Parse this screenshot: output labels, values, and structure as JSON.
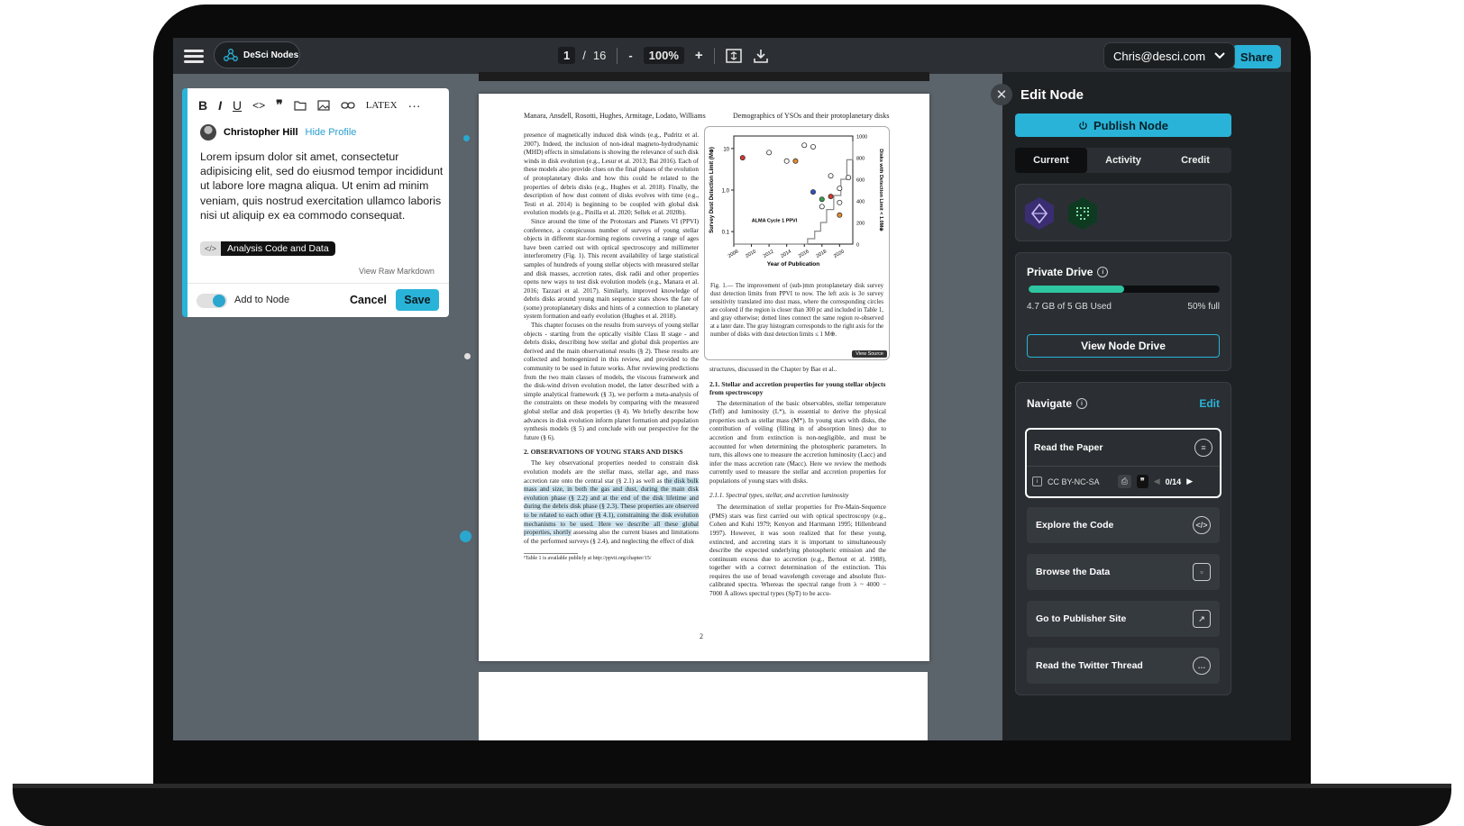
{
  "brand": {
    "name": "DeSci Nodes"
  },
  "toolbar": {
    "page_current": "1",
    "page_separator": "/",
    "page_total": "16",
    "zoom_out": "-",
    "zoom": "100%",
    "zoom_in": "+",
    "share_label": "Share",
    "user_email": "Chris@desci.com"
  },
  "editor": {
    "tools": [
      "B",
      "I",
      "U",
      "<>",
      "❞",
      "LATEX",
      "···"
    ],
    "author_name": "Christopher Hill",
    "hide_profile": "Hide Profile",
    "text": "Lorem ipsum dolor sit amet, consectetur adipisicing elit, sed do eiusmod tempor incididunt ut labore    lore magna aliqua. Ut enim ad minim veniam, quis nostrud exercitation ullamco laboris nisi ut aliquip ex ea commodo consequat.",
    "chip_icon": "</>",
    "chip_label": "Analysis Code and Data",
    "view_raw": "View Raw Markdown",
    "add_to_node": "Add to Node",
    "cancel": "Cancel",
    "save": "Save"
  },
  "pdf": {
    "running_head_left": "Manara, Ansdell, Rosotti, Hughes, Armitage, Lodato, Williams",
    "running_head_right": "Demographics of YSOs and their protoplanetary disks",
    "left_col_1": "presence of magnetically induced disk winds (e.g., Pudritz et al. 2007). Indeed, the inclusion of non-ideal magneto-hydrodynamic (MHD) effects in simulations is showing the relevance of such disk winds in disk evolution (e.g., Lesur et al. 2013; Bai 2016). Each of these models also provide clues on the final phases of the evolution of protoplanetary disks and how this could be related to the properties of debris disks (e.g., Hughes et al. 2018). Finally, the description of how dust content of disks evolves with time (e.g., Testi et al. 2014) is beginning to be coupled with global disk evolution models (e.g., Pinilla et al. 2020; Sellek et al. 2020b).",
    "left_col_2": "Since around the time of the Protostars and Planets VI (PPVI) conference, a conspicuous number of surveys of young stellar objects in different star-forming regions covering a range of ages have been carried out with optical spectroscopy and millimeter interferometry (Fig. 1). This recent availability of large statistical samples of hundreds of young stellar objects with measured stellar and disk masses, accretion rates, disk radii and other properties opens new ways to test disk evolution models (e.g., Manara et al. 2016; Tazzari et al. 2017). Similarly, improved knowledge of debris disks around young main sequence stars shows the fate of (some) protoplanetary disks and hints of a connection to planetary system formation and early evolution (Hughes et al. 2018).",
    "left_col_3": "This chapter focuses on the results from surveys of young stellar objects - starting from the optically visible Class II stage - and debris disks, describing how stellar and global disk properties are derived and the main observational results (§ 2). These results are collected and homogenized in this review, and provided to the community to be used in future works. After reviewing predictions from the two main classes of models, the viscous framework and the disk-wind driven evolution model, the latter described with a simple analytical framework (§ 3), we perform a meta-analysis of the constraints on these models by comparing with the measured global stellar and disk properties (§ 4). We briefly describe how advances in disk evolution inform planet formation and population synthesis models (§ 5) and conclude with our perspective for the future (§ 6).",
    "heading_2": "2.   OBSERVATIONS OF YOUNG STARS AND DISKS",
    "left_col_4a": "The key observational properties needed to constrain disk evolution models are the stellar mass, stellar age, and mass accretion rate onto the central star (§ 2.1) as well as",
    "left_col_4_highlight": "the disk bulk mass and size, in both the gas and dust, during the main disk evolution phase (§ 2.2) and at the end of the disk lifetime and during the debris disk phase (§ 2.3). These properties are observed to be related to each other (§ 4.1), constraining the disk evolution mechanisms to be used. Here we describe all these global properties, shortly",
    "left_col_4b": "assessing also the current biases and limitations of the performed surveys (§ 2.4), and neglecting the effect of disk",
    "footnote": "¹Table 1 is available publicly at http://ppvii.org/chapter/15/",
    "fig_caption": "Fig. 1.— The improvement of (sub-)mm protoplanetary disk survey dust detection limits from PPVI to now. The left axis is 3σ survey sensitivity translated into dust mass, where the corresponding circles are colored if the region is closer than 300 pc and included in Table 1, and gray otherwise; dotted lines connect the same region re-observed at a later date. The gray histogram corresponds to the right axis for the number of disks with dust detection limits ≤ 1 M⊕.",
    "view_source": "View Source",
    "right_col_1": "structures, discussed in the Chapter by Bae et al..",
    "heading_21": "2.1.   Stellar and accretion properties for young stellar objects from spectroscopy",
    "right_col_2": "The determination of the basic observables, stellar temperature (Teff) and luminosity (L*), is essential to derive the physical properties such as stellar mass (M*). In young stars with disks, the contribution of veiling (filling in of absorption lines) due to accretion and from extinction is non-negligible, and must be accounted for when determining the photospheric parameters. In turn, this allows one to measure the accretion luminosity (Lacc) and infer the mass accretion rate (Ṁacc). Here we review the methods currently used to measure the stellar and accretion properties for populations of young stars with disks.",
    "heading_211": "2.1.1.   Spectral types, stellar, and accretion luminosity",
    "right_col_3": "The determination of stellar properties for Pre-Main-Sequence (PMS) stars was first carried out with optical spectroscopy (e.g., Cohen and Kuhi 1979; Kenyon and Hartmann 1995; Hillenbrand 1997). However, it was soon realized that for these young, extincted, and accreting stars it is important to simultaneously describe the expected underlying photospheric emission and the continuum excess due to accretion (e.g., Bertout et al. 1988), together with a correct determination of the extinction. This requires the use of broad wavelength coverage and absolute flux-calibrated spectra. Whereas the spectral range from λ ~ 4000 − 7000 Å allows spectral types (SpT) to be accu-",
    "page_number": "2"
  },
  "chart_data": {
    "type": "scatter",
    "title": "",
    "xlabel": "Year of Publication",
    "ylabel": "Survey Dust Detection Limit (M⊕)",
    "y2label": "Disks with Detection Limit < 1.0M⊕",
    "xticks": [
      "2008",
      "2010",
      "2012",
      "2014",
      "2016",
      "2018",
      "2020"
    ],
    "yticks": [
      "0.1",
      "1.0",
      "10"
    ],
    "y2ticks": [
      "0",
      "200",
      "400",
      "600",
      "800",
      "1000"
    ],
    "annotation": "ALMA Cycle 1 PPVI",
    "points": [
      {
        "x": 2009,
        "y": 6,
        "color": "#d9362b"
      },
      {
        "x": 2012,
        "y": 8,
        "color": "#ffffff"
      },
      {
        "x": 2014,
        "y": 5,
        "color": "#ffffff"
      },
      {
        "x": 2015,
        "y": 5,
        "color": "#e88a2b"
      },
      {
        "x": 2016,
        "y": 12,
        "color": "#ffffff"
      },
      {
        "x": 2017,
        "y": 11,
        "color": "#ffffff"
      },
      {
        "x": 2017,
        "y": 0.9,
        "color": "#2a53c9"
      },
      {
        "x": 2018,
        "y": 0.6,
        "color": "#3aa04a"
      },
      {
        "x": 2018,
        "y": 0.4,
        "color": "#ffffff"
      },
      {
        "x": 2019,
        "y": 0.7,
        "color": "#d9362b"
      },
      {
        "x": 2019,
        "y": 2.2,
        "color": "#ffffff"
      },
      {
        "x": 2020,
        "y": 1.1,
        "color": "#ffffff"
      },
      {
        "x": 2020,
        "y": 0.5,
        "color": "#ffffff"
      },
      {
        "x": 2020,
        "y": 0.25,
        "color": "#e88a2b"
      },
      {
        "x": 2021,
        "y": 2.0,
        "color": "#ffffff"
      }
    ]
  },
  "panel": {
    "title": "Edit Node",
    "publish": "Publish Node",
    "tabs": [
      "Current",
      "Activity",
      "Credit"
    ],
    "drive_title": "Private Drive",
    "drive_used": "4.7 GB of 5 GB Used",
    "drive_full": "50% full",
    "drive_fraction": 0.5,
    "view_drive": "View Node Drive",
    "navigate": "Navigate",
    "edit": "Edit",
    "read_paper": "Read the Paper",
    "license": "CC BY-NC-SA",
    "cite_count": "0/14",
    "nav_items": [
      "Explore the Code",
      "Browse the Data",
      "Go to Publisher Site",
      "Read the Twitter Thread"
    ],
    "accent": "#2ab3d8"
  }
}
